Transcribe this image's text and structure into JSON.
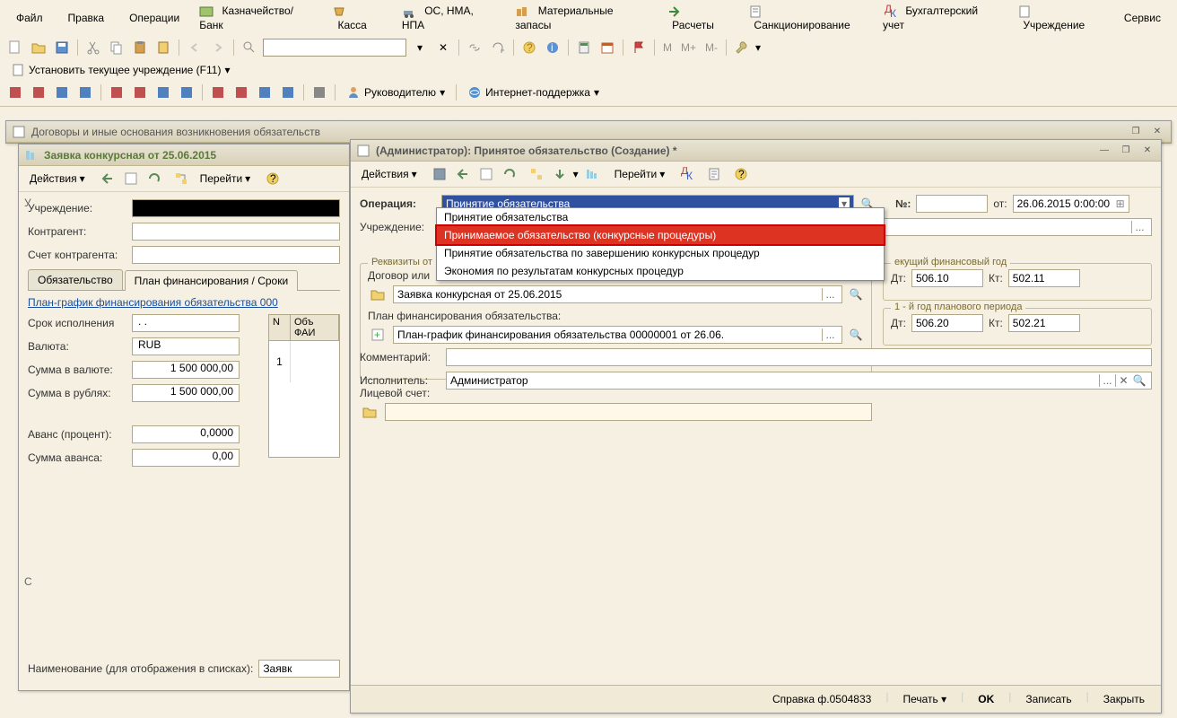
{
  "menu": {
    "file": "Файл",
    "edit": "Правка",
    "ops": "Операции",
    "treasury": "Казначейство/Банк",
    "cash": "Касса",
    "os": "ОС, НМА, НПА",
    "materials": "Материальные запасы",
    "settlements": "Расчеты",
    "sanctioning": "Санкционирование",
    "accounting": "Бухгалтерский учет",
    "institution": "Учреждение",
    "service": "Сервис"
  },
  "toolbar": {
    "set_institution": "Установить текущее учреждение (F11)",
    "dropdown_arrow": "▾",
    "manager": "Руководителю",
    "support": "Интернет-поддержка",
    "m": "M",
    "mplus": "M+",
    "mminus": "M-"
  },
  "bgwin": {
    "title": "Договоры и иные основания возникновения обязательств"
  },
  "leftwin": {
    "title": "Заявка конкурсная  от 25.06.2015",
    "actions": "Действия",
    "goto": "Перейти",
    "u": "У",
    "c": "С",
    "inst_lbl": "Учреждение:",
    "contragent_lbl": "Контрагент:",
    "acct_lbl": "Счет контрагента:",
    "tab1": "Обязательство",
    "tab2": "План финансирования / Сроки",
    "planlink": "План-график финансирования обязательства 000",
    "deadline_lbl": "Срок исполнения",
    "deadline_val": ". .",
    "currency_lbl": "Валюта:",
    "currency_val": "RUB",
    "sum_curr_lbl": "Сумма в валюте:",
    "sum_curr_val": "1 500 000,00",
    "sum_rub_lbl": "Сумма в рублях:",
    "sum_rub_val": "1 500 000,00",
    "avans_pct_lbl": "Аванс (процент):",
    "avans_pct_val": "0,0000",
    "avans_sum_lbl": "Сумма аванса:",
    "avans_sum_val": "0,00",
    "col_n": "N",
    "col_obj": "Объ\nФАИ",
    "one": "1",
    "naming_lbl": "Наименование (для отображения в списках):",
    "naming_val": "Заявк"
  },
  "mainwin": {
    "title": "(Администратор): Принятое обязательство (Создание) *",
    "actions": "Действия",
    "goto": "Перейти",
    "op_lbl": "Операция:",
    "op_val": "Принятие обязательства",
    "num_lbl": "№:",
    "num_val": "",
    "from_lbl": "от:",
    "from_val": "26.06.2015  0:00:00",
    "inst_lbl": "Учреждение:",
    "req_group": "Реквизиты от",
    "contract_lbl": "Договор или",
    "contract_val": "Заявка конкурсная  от 25.06.2015",
    "plan_lbl": "План финансирования обязательства:",
    "plan_val": "План-график финансирования обязательства 00000001 от 26.06.",
    "ls_lbl": "Лицевой счет:",
    "cur_year": "екущий финансовый год",
    "year1": "1 - й год планового периода",
    "dt": "Дт:",
    "kt": "Кт:",
    "dt1": "506.10",
    "kt1": "502.11",
    "dt2": "506.20",
    "kt2": "502.21",
    "comment_lbl": "Комментарий:",
    "executor_lbl": "Исполнитель:",
    "executor_val": "Администратор",
    "ref": "Справка ф.0504833",
    "print": "Печать",
    "ok": "OK",
    "save": "Записать",
    "close": "Закрыть"
  },
  "dropdown": {
    "opt1": "Принятие обязательства",
    "opt2": "Принимаемое обязательство (конкурсные процедуры)",
    "opt3": "Принятие обязательства по завершению конкурсных процедур",
    "opt4": "Экономия по результатам конкурсных процедур"
  }
}
